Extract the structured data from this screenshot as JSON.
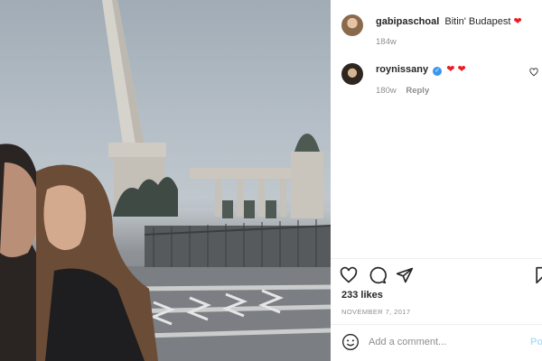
{
  "caption": {
    "username": "gabipaschoal",
    "text": "Bitin' Budapest",
    "emoji": "red-heart",
    "time": "184w"
  },
  "comment": {
    "username": "roynissany",
    "verified": true,
    "emoji": "two-red-hearts",
    "time": "180w",
    "reply_label": "Reply"
  },
  "actions": {
    "icons": [
      "heart-outline-icon",
      "comment-icon",
      "share-icon",
      "save-icon"
    ]
  },
  "likes_text": "233 likes",
  "date_text": "NOVEMBER 7, 2017",
  "add_comment": {
    "placeholder": "Add a comment...",
    "post_label": "Po"
  },
  "colors": {
    "accent": "#3897f0",
    "heart": "#ed1c24",
    "muted": "#8e8e8e",
    "post_disabled": "#b2dffc"
  }
}
